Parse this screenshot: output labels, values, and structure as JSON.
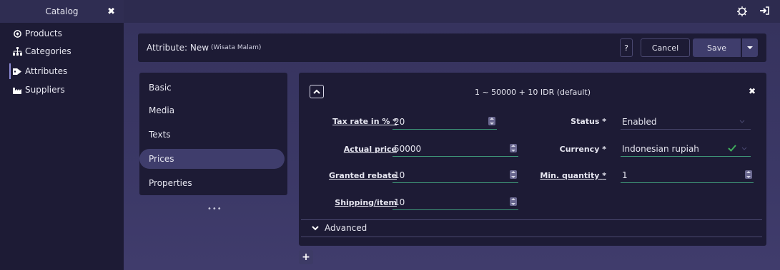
{
  "sidebar": {
    "title": "Catalog",
    "items": [
      {
        "label": "Products",
        "icon": "products-icon"
      },
      {
        "label": "Categories",
        "icon": "sitemap-icon"
      },
      {
        "label": "Attributes",
        "icon": "tag-icon"
      },
      {
        "label": "Suppliers",
        "icon": "industry-icon"
      }
    ]
  },
  "header": {
    "title": "Attribute: New",
    "subtitle": "(Wisata Malam)",
    "help_label": "?",
    "cancel_label": "Cancel",
    "save_label": "Save"
  },
  "tabs": [
    "Basic",
    "Media",
    "Texts",
    "Prices",
    "Properties"
  ],
  "more_label": "•••",
  "price": {
    "title": "1 ~ 50000 + 10 IDR (default)",
    "fields": {
      "tax_rate": {
        "label": "Tax rate in %",
        "required": "*",
        "value": "20"
      },
      "actual_price": {
        "label": "Actual price",
        "value": "50000"
      },
      "granted_rebate": {
        "label": "Granted rebate",
        "value": "10"
      },
      "shipping": {
        "label": "Shipping/item",
        "value": "10"
      },
      "status": {
        "label": "Status",
        "required": "*",
        "value": "Enabled"
      },
      "currency": {
        "label": "Currency",
        "required": "*",
        "value": "Indonesian rupiah"
      },
      "min_quantity": {
        "label": "Min. quantity",
        "required": "*",
        "value": "1"
      }
    },
    "advanced_label": "Advanced"
  },
  "add_label": "+",
  "colors": {
    "sidebar_bg": "#1d1b35",
    "card_bg": "#1d1b35",
    "main_bg": "#3b3866",
    "save_button": "#3f3d6c",
    "valid_underline": "#3f9a7a",
    "check": "#3fae5c"
  }
}
